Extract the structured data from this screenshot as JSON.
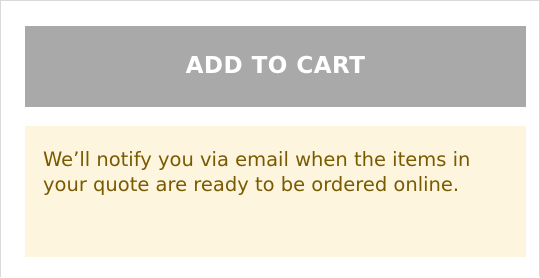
{
  "cart": {
    "add_to_cart_label": "ADD TO CART"
  },
  "notice": {
    "message": "We’ll notify you via email when the items in your quote are ready to be ordered online."
  },
  "colors": {
    "button_disabled_bg": "#a9a9a9",
    "button_text": "#ffffff",
    "notice_bg": "#fdf5dd",
    "notice_text": "#7a5a00"
  }
}
